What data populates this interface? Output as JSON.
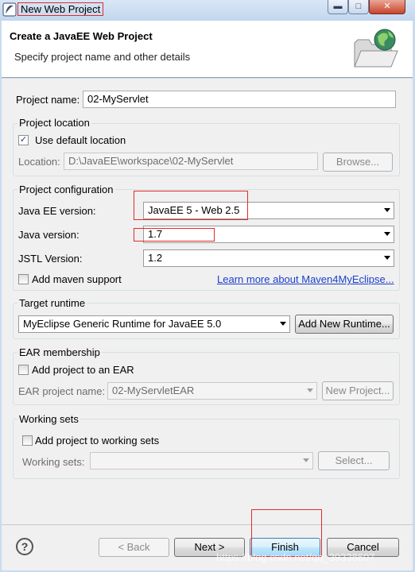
{
  "window": {
    "title": "New Web Project"
  },
  "header": {
    "title": "Create a JavaEE Web Project",
    "subtitle": "Specify project name and other details"
  },
  "project_name": {
    "label": "Project name:",
    "value": "02-MyServlet"
  },
  "project_location": {
    "title": "Project location",
    "use_default_label": "Use default location",
    "use_default_checked": true,
    "location_label": "Location:",
    "location_value": "D:\\JavaEE\\workspace\\02-MyServlet",
    "browse_label": "Browse..."
  },
  "project_configuration": {
    "title": "Project configuration",
    "javaee_label": "Java EE version:",
    "javaee_value": "JavaEE 5 - Web 2.5",
    "java_label": "Java version:",
    "java_value": "1.7",
    "jstl_label": "JSTL Version:",
    "jstl_value": "1.2",
    "maven_label": "Add maven support",
    "maven_link": "Learn more about Maven4MyEclipse..."
  },
  "target_runtime": {
    "title": "Target runtime",
    "value": "MyEclipse Generic Runtime for JavaEE 5.0",
    "new_runtime_label": "Add New Runtime..."
  },
  "ear_membership": {
    "title": "EAR membership",
    "add_label": "Add project to an EAR",
    "ear_name_label": "EAR project name:",
    "ear_name_value": "02-MyServletEAR",
    "new_project_label": "New Project..."
  },
  "working_sets": {
    "title": "Working sets",
    "add_label": "Add project to working sets",
    "sets_label": "Working sets:",
    "sets_value": "",
    "select_label": "Select..."
  },
  "footer": {
    "back_label": "< Back",
    "next_label": "Next >",
    "finish_label": "Finish",
    "cancel_label": "Cancel",
    "watermark": "https://blog.csdn.net/qq_39338607"
  },
  "colors": {
    "annotation_red": "#e02b2b",
    "link_blue": "#1a3fcc",
    "check_blue": "#1d3c85"
  }
}
